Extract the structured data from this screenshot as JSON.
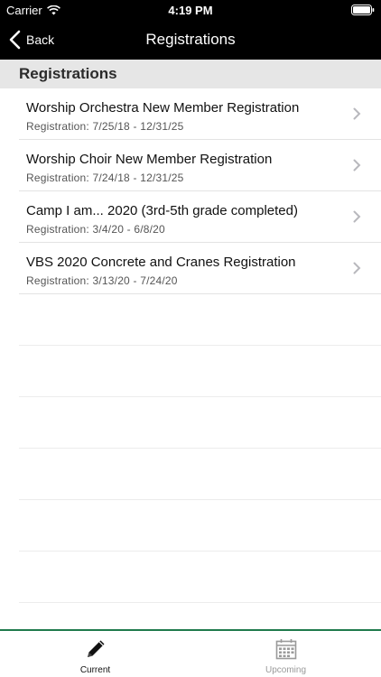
{
  "status_bar": {
    "carrier": "Carrier",
    "time": "4:19 PM"
  },
  "nav": {
    "back_label": "Back",
    "title": "Registrations"
  },
  "section": {
    "header": "Registrations"
  },
  "registrations": [
    {
      "title": "Worship Orchestra New Member Registration",
      "subtitle": "Registration: 7/25/18 - 12/31/25"
    },
    {
      "title": "Worship Choir New Member Registration",
      "subtitle": "Registration: 7/24/18 - 12/31/25"
    },
    {
      "title": "Camp I am... 2020 (3rd-5th grade completed)",
      "subtitle": "Registration: 3/4/20 - 6/8/20"
    },
    {
      "title": "VBS 2020 Concrete and Cranes Registration",
      "subtitle": "Registration: 3/13/20 - 7/24/20"
    }
  ],
  "tabs": {
    "current_label": "Current",
    "upcoming_label": "Upcoming"
  },
  "colors": {
    "bar_background": "#000000",
    "section_background": "#e6e6e6",
    "tab_accent": "#1f7a4c",
    "tab_inactive": "#9a9a9a"
  }
}
